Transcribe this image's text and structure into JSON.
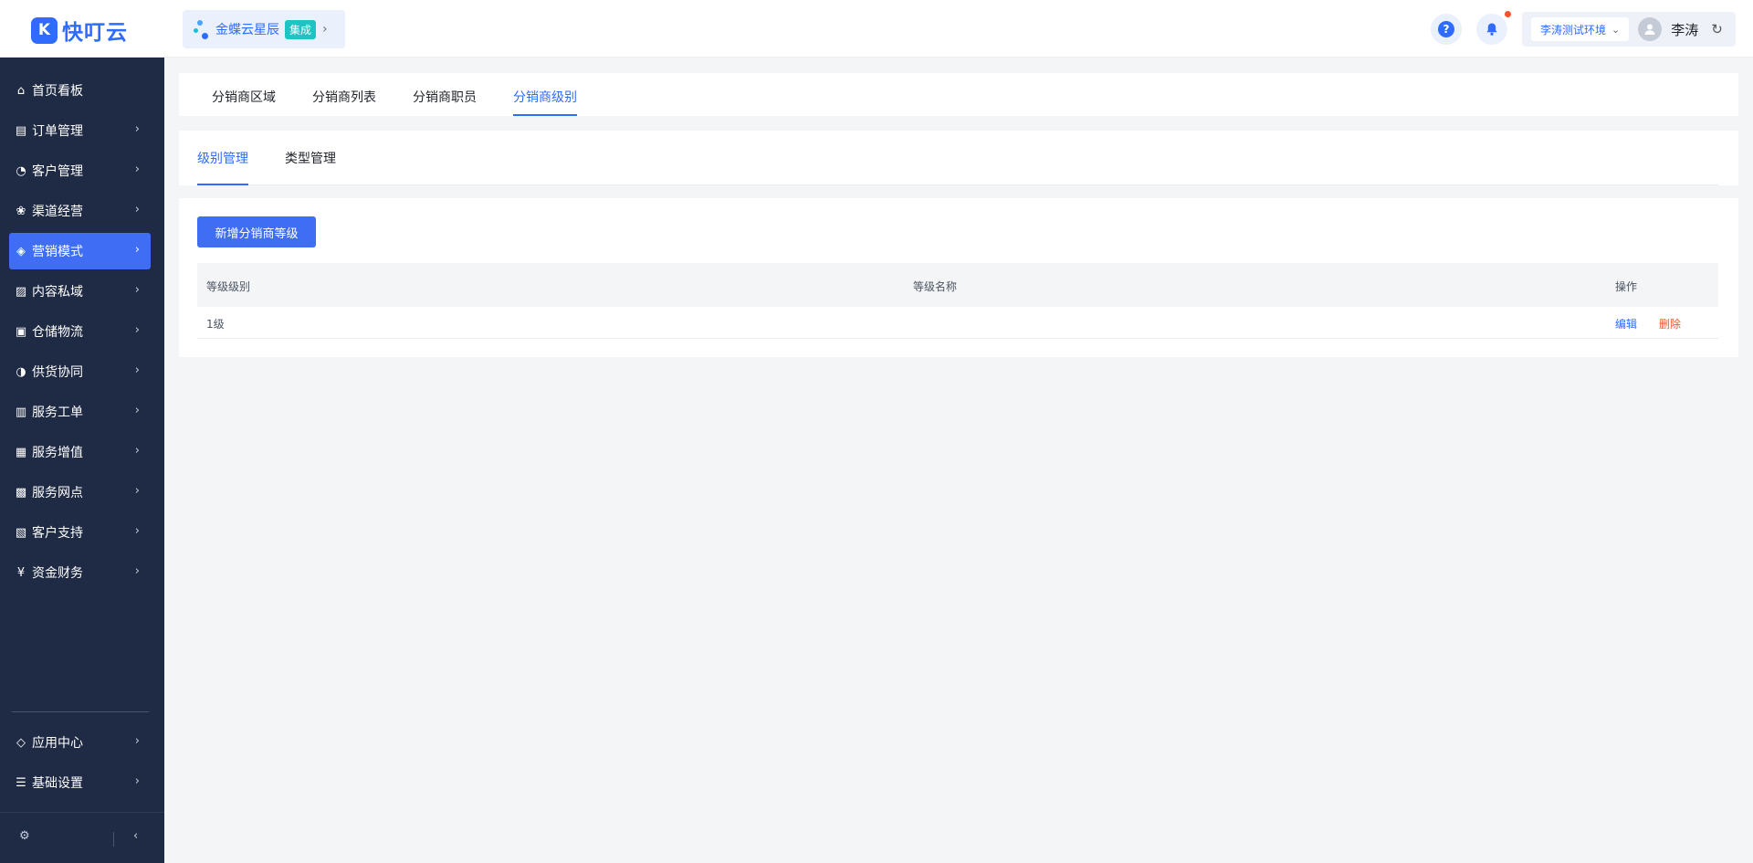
{
  "brand": {
    "logo_glyph": "K",
    "name": "快叮云"
  },
  "app": {
    "name": "金蝶云星辰",
    "badge": "集成"
  },
  "header": {
    "help_glyph": "?",
    "environment": "李涛测试环境",
    "user_name": "李涛"
  },
  "sidebar": {
    "items": [
      {
        "label": "首页看板",
        "icon": "home-icon",
        "glyph": "⌂",
        "has_arrow": false
      },
      {
        "label": "订单管理",
        "icon": "order-icon",
        "glyph": "▤",
        "has_arrow": true
      },
      {
        "label": "客户管理",
        "icon": "user-icon",
        "glyph": "◔",
        "has_arrow": true
      },
      {
        "label": "渠道经营",
        "icon": "channel-icon",
        "glyph": "❀",
        "has_arrow": true
      },
      {
        "label": "营销模式",
        "icon": "tag-icon",
        "glyph": "◈",
        "has_arrow": true,
        "active": true
      },
      {
        "label": "内容私域",
        "icon": "image-icon",
        "glyph": "▨",
        "has_arrow": true
      },
      {
        "label": "仓储物流",
        "icon": "warehouse-icon",
        "glyph": "▣",
        "has_arrow": true
      },
      {
        "label": "供货协同",
        "icon": "supply-icon",
        "glyph": "◑",
        "has_arrow": true
      },
      {
        "label": "服务工单",
        "icon": "ticket-icon",
        "glyph": "▥",
        "has_arrow": true
      },
      {
        "label": "服务增值",
        "icon": "bag-icon",
        "glyph": "▦",
        "has_arrow": true
      },
      {
        "label": "服务网点",
        "icon": "store-icon",
        "glyph": "▩",
        "has_arrow": true
      },
      {
        "label": "客户支持",
        "icon": "support-icon",
        "glyph": "▧",
        "has_arrow": true
      },
      {
        "label": "资金财务",
        "icon": "yen-icon",
        "glyph": "¥",
        "has_arrow": true
      }
    ],
    "bottom_items": [
      {
        "label": "应用中心",
        "icon": "cube-icon",
        "glyph": "◇",
        "has_arrow": true
      },
      {
        "label": "基础设置",
        "icon": "settings-list-icon",
        "glyph": "☰",
        "has_arrow": true
      }
    ]
  },
  "top_tabs": [
    {
      "label": "分销商区域"
    },
    {
      "label": "分销商列表"
    },
    {
      "label": "分销商职员"
    },
    {
      "label": "分销商级别",
      "active": true
    }
  ],
  "sub_tabs": [
    {
      "label": "级别管理",
      "active": true
    },
    {
      "label": "类型管理"
    }
  ],
  "table": {
    "add_button": "新增分销商等级",
    "columns": [
      "等级级别",
      "等级名称",
      "操作"
    ],
    "rows": [
      {
        "level": "1级",
        "name": "",
        "edit": "编辑",
        "delete": "删除"
      }
    ]
  },
  "colors": {
    "primary": "#2f6bff",
    "sidebar_bg": "#1f2a44",
    "active_item": "#3f6ef5",
    "danger": "#f5532d"
  }
}
